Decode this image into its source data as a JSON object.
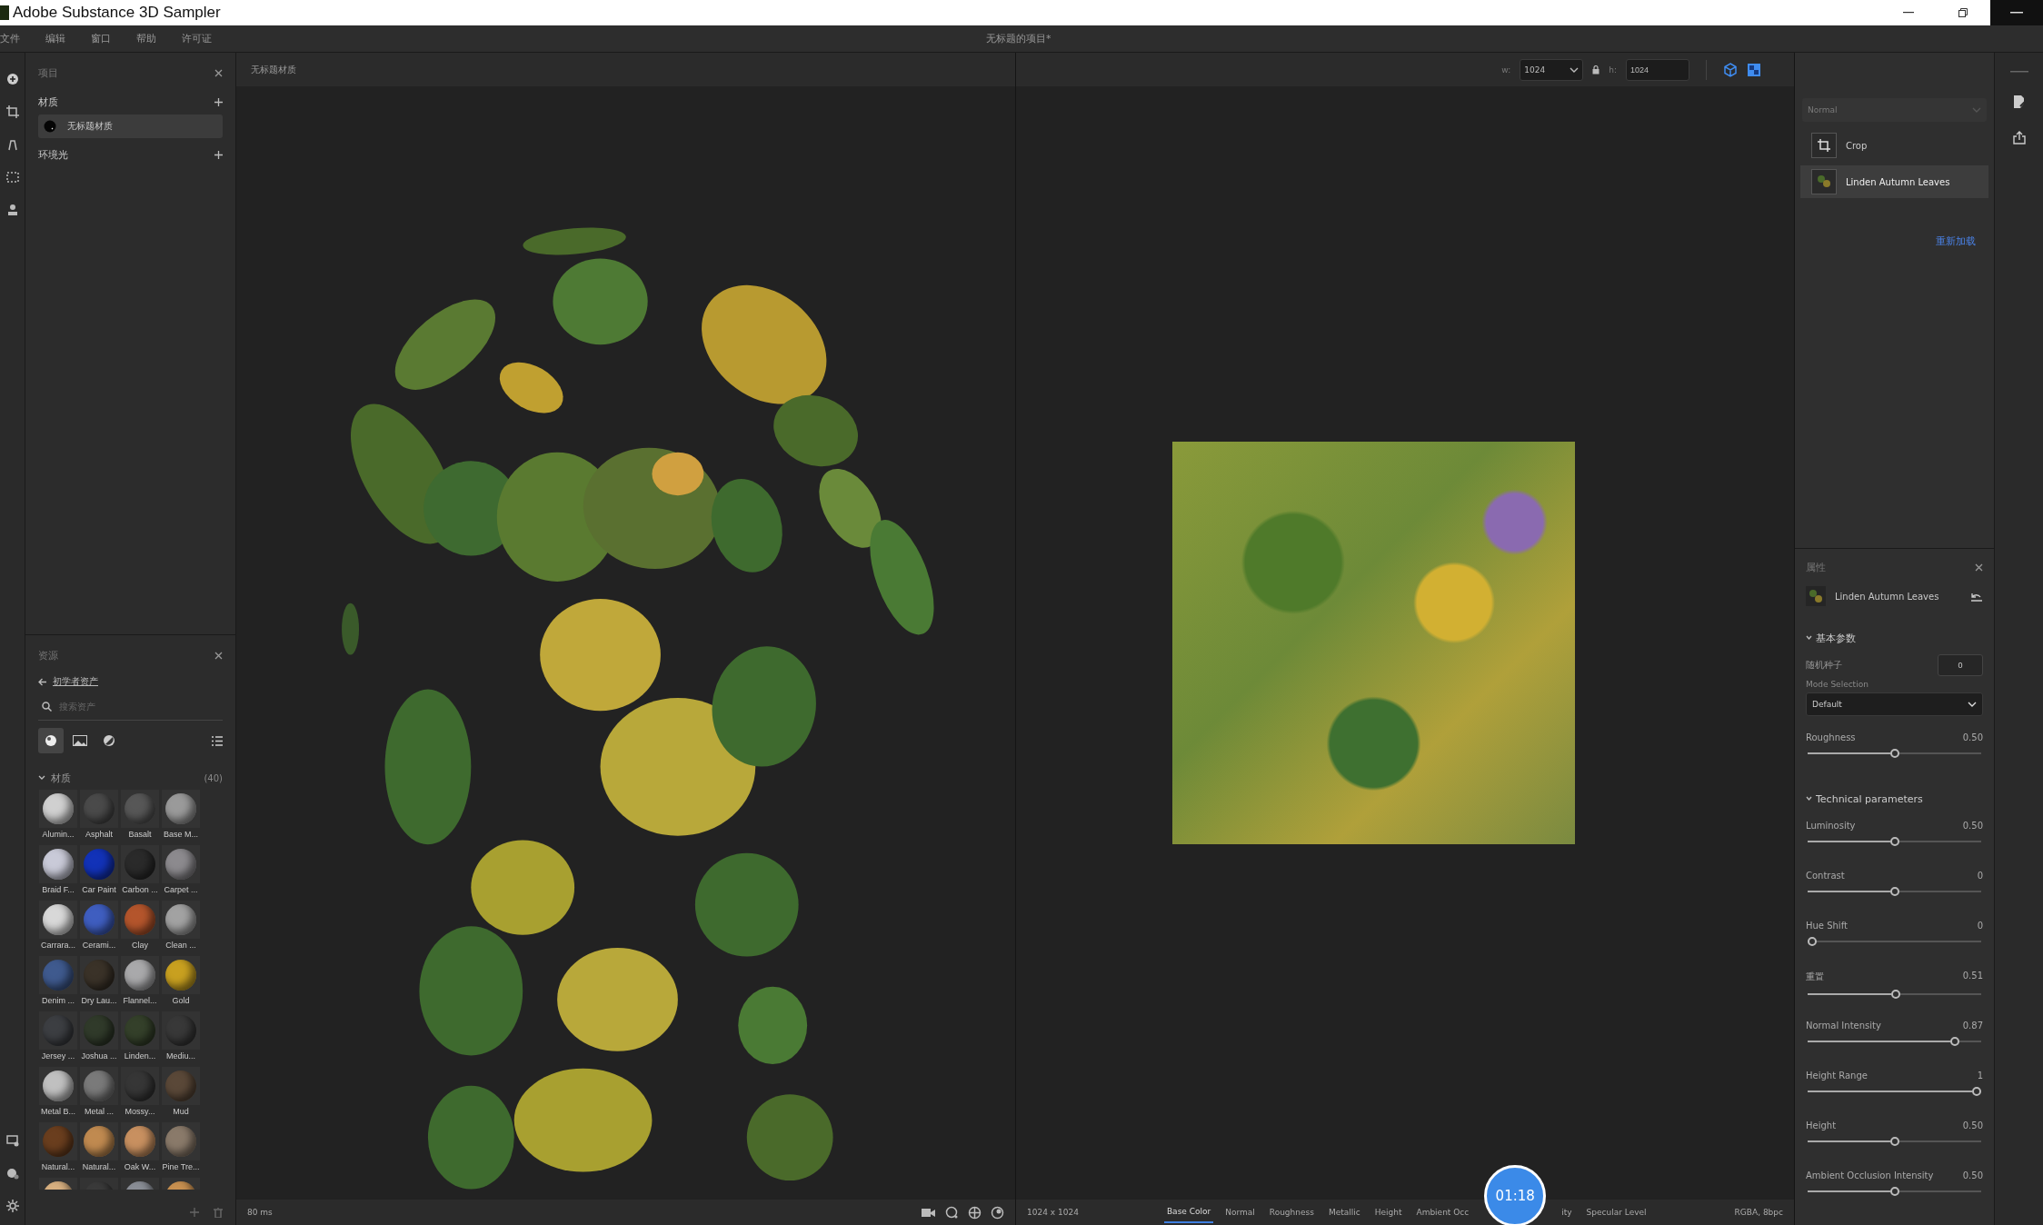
{
  "window": {
    "title": "Adobe Substance 3D Sampler"
  },
  "menu": [
    "文件",
    "编辑",
    "窗口",
    "帮助",
    "许可证"
  ],
  "project_title": "无标题的项目*",
  "project_panel": {
    "title": "项目",
    "sections": [
      {
        "title": "材质",
        "items": [
          {
            "label": "无标题材质",
            "selected": true
          }
        ]
      },
      {
        "title": "环境光"
      }
    ]
  },
  "assets_panel": {
    "title": "资源",
    "breadcrumb": "初学者资产",
    "search": {
      "placeholder": "搜索资产"
    },
    "filters": [
      {
        "kind": "material",
        "selected": true
      },
      {
        "kind": "image",
        "selected": false
      },
      {
        "kind": "environment",
        "selected": false
      }
    ],
    "group": {
      "title": "材质",
      "count": "(40)",
      "expanded": true,
      "items": [
        {
          "name": "Alumin...",
          "color": "#d0d0d0"
        },
        {
          "name": "Asphalt",
          "color": "#4a4a4a"
        },
        {
          "name": "Basalt",
          "color": "#575757"
        },
        {
          "name": "Base M...",
          "color": "#9a9a9a"
        },
        {
          "name": "Braid F...",
          "color": "#c9cad8"
        },
        {
          "name": "Car Paint",
          "color": "#1232b8"
        },
        {
          "name": "Carbon ...",
          "color": "#2a2a2a"
        },
        {
          "name": "Carpet ...",
          "color": "#8c8a8e"
        },
        {
          "name": "Carrara...",
          "color": "#d8d8d8"
        },
        {
          "name": "Cerami...",
          "color": "#3f5ec0"
        },
        {
          "name": "Clay",
          "color": "#b4552c"
        },
        {
          "name": "Clean ...",
          "color": "#a2a2a2"
        },
        {
          "name": "Denim ...",
          "color": "#3f5a8e"
        },
        {
          "name": "Dry Lau...",
          "color": "#3a3228"
        },
        {
          "name": "Flannel...",
          "color": "#a9a9ab"
        },
        {
          "name": "Gold",
          "color": "#c8a020"
        },
        {
          "name": "Jersey ...",
          "color": "#3c3e42"
        },
        {
          "name": "Joshua ...",
          "color": "#303a2a"
        },
        {
          "name": "Linden...",
          "color": "#34402a"
        },
        {
          "name": "Mediu...",
          "color": "#383838"
        },
        {
          "name": "Metal B...",
          "color": "#c0c0c0"
        },
        {
          "name": "Metal ...",
          "color": "#7a7a7a"
        },
        {
          "name": "Mossy...",
          "color": "#363636"
        },
        {
          "name": "Mud",
          "color": "#5a4838"
        },
        {
          "name": "Natural...",
          "color": "#6a3e1e"
        },
        {
          "name": "Natural...",
          "color": "#c08a50"
        },
        {
          "name": "Oak W...",
          "color": "#c89060"
        },
        {
          "name": "Pine Tre...",
          "color": "#8a7a6a"
        },
        {
          "color": "#d8b080"
        },
        {
          "color": "#3a3a3a"
        },
        {
          "color": "#8a8e96"
        },
        {
          "color": "#c89050"
        }
      ]
    }
  },
  "viewport_3d": {
    "title": "无标题材质",
    "frame_time": "80 ms"
  },
  "viewport_2d": {
    "width": {
      "label": "w:",
      "value": "1024"
    },
    "height": {
      "label": "h:",
      "value": "1024"
    },
    "resolution": "1024 x 1024",
    "channels": [
      {
        "label": "Base Color",
        "selected": true
      },
      {
        "label": "Normal",
        "selected": false
      },
      {
        "label": "Roughness",
        "selected": false
      },
      {
        "label": "Metallic",
        "selected": false
      },
      {
        "label": "Height",
        "selected": false
      },
      {
        "label": "Ambient Occ",
        "selected": false
      },
      {
        "label": "ity",
        "selected": false
      },
      {
        "label": "Specular Level",
        "selected": false
      }
    ],
    "format": "RGBA, 8bpc"
  },
  "timer": "01:18",
  "layers_panel": {
    "blend_mode": {
      "value": "Normal",
      "disabled": true
    },
    "layers": [
      {
        "kind": "crop",
        "name": "Crop",
        "selected": false
      },
      {
        "kind": "material",
        "name": "Linden Autumn Leaves",
        "selected": true
      }
    ],
    "reload_link": "重新加载"
  },
  "properties_panel": {
    "title": "属性",
    "source": "Linden Autumn Leaves",
    "sections": [
      {
        "title": "基本参数",
        "expanded": true,
        "params": [
          {
            "kind": "number",
            "label": "随机种子",
            "value": "0"
          },
          {
            "kind": "dropdown",
            "label": "Mode Selection",
            "value": "Default"
          },
          {
            "kind": "slider",
            "label": "Roughness",
            "reading": "0.50",
            "level": 0.5
          }
        ]
      },
      {
        "title": "Technical parameters",
        "expanded": true,
        "params": [
          {
            "kind": "slider",
            "label": "Luminosity",
            "reading": "0.50",
            "level": 0.5
          },
          {
            "kind": "slider",
            "label": "Contrast",
            "reading": "0",
            "level": 0.5
          },
          {
            "kind": "slider",
            "label": "Hue Shift",
            "reading": "0",
            "level": 0
          },
          {
            "kind": "slider",
            "label": "重置",
            "reading": "0.51",
            "level": 0.51
          },
          {
            "kind": "slider",
            "label": "Normal Intensity",
            "reading": "0.87",
            "level": 0.87
          },
          {
            "kind": "slider",
            "label": "Height Range",
            "reading": "1",
            "level": 1
          },
          {
            "kind": "slider",
            "label": "Height",
            "reading": "0.50",
            "level": 0.5
          },
          {
            "kind": "slider",
            "label": "Ambient Occlusion Intensity",
            "reading": "0.50",
            "level": 0.5
          }
        ]
      }
    ]
  }
}
